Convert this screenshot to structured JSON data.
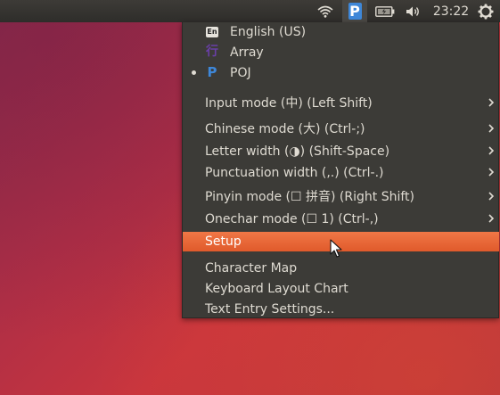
{
  "panel": {
    "clock": "23:22",
    "indicators": {
      "wifi": "wifi-icon",
      "ime": "P",
      "battery": "battery-icon",
      "sound": "sound-icon",
      "system": "gear-icon"
    }
  },
  "menu": {
    "input_methods": [
      {
        "icon_text": "En",
        "label": "English (US)",
        "active": false
      },
      {
        "icon_text": "行",
        "label": "Array",
        "active": false
      },
      {
        "icon_text": "P",
        "label": "POJ",
        "active": true
      }
    ],
    "modes": [
      {
        "label": "Input mode (中) (Left Shift)"
      },
      {
        "label": "Chinese mode (大) (Ctrl-;)"
      },
      {
        "label": "Letter width (◑) (Shift-Space)"
      },
      {
        "label": "Punctuation width (,.) (Ctrl-.)"
      },
      {
        "label": "Pinyin mode (☐ 拼音) (Right Shift)"
      },
      {
        "label": "Onechar mode (☐ 1) (Ctrl-,)"
      }
    ],
    "setup_label": "Setup",
    "tools": [
      {
        "label": "Character Map"
      },
      {
        "label": "Keyboard Layout Chart"
      },
      {
        "label": "Text Entry Settings..."
      }
    ]
  },
  "colors": {
    "menu_bg": "#3c3b37",
    "highlight": "#e95420",
    "text": "#dfdbd2",
    "ime_blue": "#3e87d8"
  }
}
